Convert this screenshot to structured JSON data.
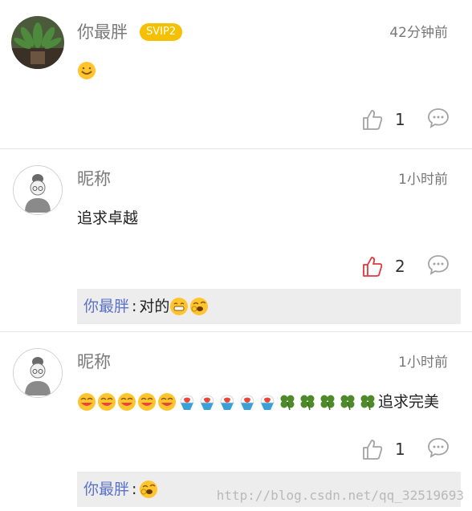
{
  "comments": [
    {
      "name": "你最胖",
      "badge": "SVIP2",
      "time": "42分钟前",
      "text": "",
      "emojis": [
        "smile-emoji"
      ],
      "likes": "1",
      "liked": false
    },
    {
      "name": "昵称",
      "time": "1小时前",
      "text": "追求卓越",
      "likes": "2",
      "liked": true,
      "reply": {
        "name": "你最胖",
        "sep": ":",
        "text": "对的"
      }
    },
    {
      "name": "昵称",
      "time": "1小时前",
      "text": "追求完美",
      "emojis": [
        "laugh-emoji",
        "laugh-emoji",
        "laugh-emoji",
        "laugh-emoji",
        "laugh-emoji",
        "shaved-ice-emoji",
        "shaved-ice-emoji",
        "shaved-ice-emoji",
        "shaved-ice-emoji",
        "shaved-ice-emoji",
        "clover-emoji",
        "clover-emoji",
        "clover-emoji",
        "clover-emoji",
        "clover-emoji"
      ],
      "likes": "1",
      "liked": false,
      "reply": {
        "name": "你最胖",
        "sep": ":",
        "text": ""
      }
    }
  ],
  "watermark": "http://blog.csdn.net/qq_32519693",
  "colors": {
    "liked": "#e0383b",
    "normal_icon": "#a3a3a3",
    "reply_name": "#5b72c9",
    "badge": "#f5c000"
  }
}
